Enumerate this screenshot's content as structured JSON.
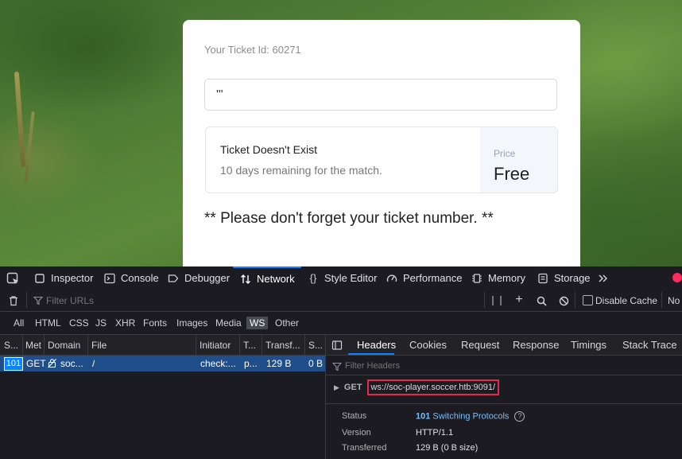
{
  "page": {
    "ticket_id": "Your Ticket Id: 60271",
    "input_value": "'''",
    "result_title": "Ticket Doesn't Exist",
    "result_sub": "10 days remaining for the match.",
    "price_label": "Price",
    "price_value": "Free",
    "reminder": "** Please don't forget your ticket number. **"
  },
  "devtools": {
    "tools": [
      {
        "label": "Inspector",
        "icon": "inspector-icon"
      },
      {
        "label": "Console",
        "icon": "console-icon"
      },
      {
        "label": "Debugger",
        "icon": "debugger-icon"
      },
      {
        "label": "Network",
        "icon": "network-icon"
      },
      {
        "label": "Style Editor",
        "icon": "style-editor-icon"
      },
      {
        "label": "Performance",
        "icon": "performance-icon"
      },
      {
        "label": "Memory",
        "icon": "memory-icon"
      },
      {
        "label": "Storage",
        "icon": "storage-icon"
      }
    ],
    "active_tool": "Network",
    "filter_placeholder": "Filter URLs",
    "disable_cache": "Disable Cache",
    "throttle": "No T",
    "types": [
      "All",
      "HTML",
      "CSS",
      "JS",
      "XHR",
      "Fonts",
      "Images",
      "Media",
      "WS",
      "Other"
    ],
    "selected_type": "WS",
    "columns": [
      "S...",
      "Met",
      "Domain",
      "File",
      "Initiator",
      "T...",
      "Transf...",
      "S..."
    ],
    "row": {
      "status": "101",
      "method": "GET",
      "domain": "soc...",
      "file": "/",
      "initiator": "check:...",
      "type": "p...",
      "transferred": "129 B",
      "size": "0 B"
    },
    "panel_tabs": [
      "Headers",
      "Cookies",
      "Request",
      "Response",
      "Timings",
      "Stack Trace"
    ],
    "active_panel_tab": "Headers",
    "filter_headers_placeholder": "Filter Headers",
    "request_method": "GET",
    "request_url": "ws://soc-player.soccer.htb:9091/",
    "status_label": "Status",
    "status_code": "101",
    "status_text": "Switching Protocols",
    "version_label": "Version",
    "version_value": "HTTP/1.1",
    "transferred_label": "Transferred",
    "transferred_value": "129 B (0 B size)"
  },
  "colors": {
    "accent": "#0a84ff",
    "highlight_box": "#e22850",
    "selected_row": "#204e8a"
  }
}
